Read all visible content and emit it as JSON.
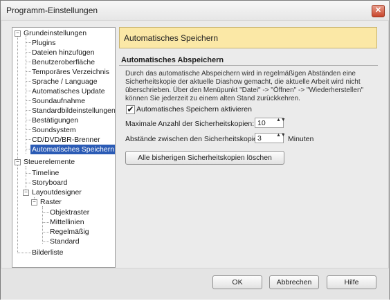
{
  "window": {
    "title": "Programm-Einstellungen",
    "close_glyph": "✕"
  },
  "tree": {
    "grundeinstellungen": {
      "label": "Grundeinstellungen",
      "children": [
        "Plugins",
        "Dateien hinzufügen",
        "Benutzeroberfläche",
        "Temporäres Verzeichnis",
        "Sprache / Language",
        "Automatisches Update",
        "Soundaufnahme",
        "Standardbildeinstellungen",
        "Bestätigungen",
        "Soundsystem",
        "CD/DVD/BR-Brenner",
        "Automatisches Speichern"
      ],
      "selected": "Automatisches Speichern"
    },
    "steuerelemente": {
      "label": "Steuerelemente",
      "children": [
        "Timeline",
        "Storyboard"
      ],
      "layoutdesigner": {
        "label": "Layoutdesigner",
        "raster": {
          "label": "Raster",
          "children": [
            "Objektraster",
            "Mittellinien",
            "Regelmäßig",
            "Standard"
          ]
        }
      }
    },
    "bilderliste": "Bilderliste",
    "expander_minus": "−"
  },
  "panel": {
    "header": "Automatisches Speichern",
    "section_title": "Automatisches Abspeichern",
    "description": "Durch das automatische Abspeichern wird in regelmäßigen Abständen eine Sicherheitskopie der aktuelle Diashow gemacht, die aktuelle Arbeit wird nicht überschrieben. Über den Menüpunkt \"Datei\" -> \"Öffnen\" -> \"Wiederherstellen\" können Sie jederzeit zu einem alten Stand zurückkehren.",
    "checkbox_label": "Automatisches Speichern aktivieren",
    "checkbox_checked": true,
    "checkbox_glyph": "✔",
    "max_copies_label": "Maximale Anzahl der Sicherheitskopien:",
    "max_copies_value": "10",
    "interval_label": "Abstände zwischen den Sicherheitskopien:",
    "interval_value": "3",
    "interval_unit": "Minuten",
    "spin_glyph": "▲▼",
    "delete_button": "Alle bisherigen Sicherheitskopien löschen"
  },
  "footer": {
    "ok": "OK",
    "cancel": "Abbrechen",
    "help": "Hilfe"
  },
  "colors": {
    "header_bg": "#fbe8a6",
    "selection": "#2b5bb5",
    "close": "#c8452b"
  },
  "icons": {
    "expander": "minus-box-icon",
    "check": "checkmark-icon",
    "spin": "spin-arrows-icon",
    "close": "close-icon"
  }
}
